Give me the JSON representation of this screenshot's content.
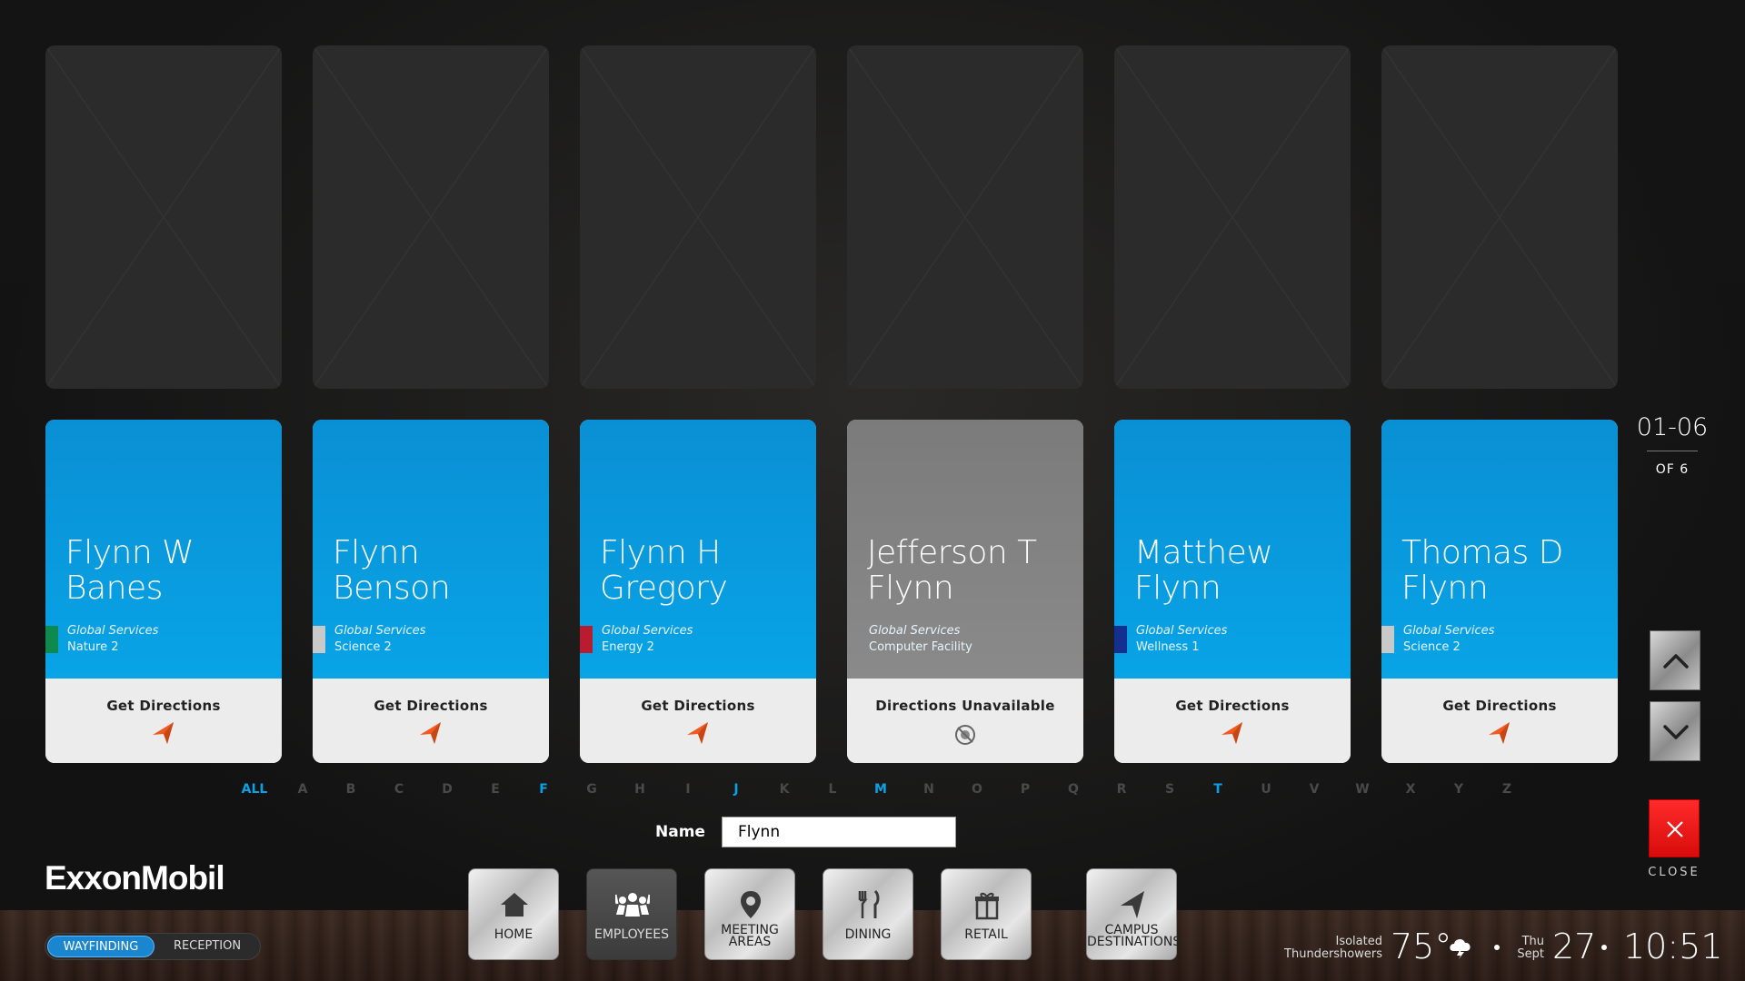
{
  "employees": [
    {
      "name": "Flynn W Banes",
      "dept": "Global Services",
      "location": "Nature 2",
      "action": "Get Directions",
      "swatch": "#0f8a4f",
      "available": true
    },
    {
      "name": "Flynn Benson",
      "dept": "Global Services",
      "location": "Science 2",
      "action": "Get Directions",
      "swatch": "#c9c9c9",
      "available": true
    },
    {
      "name": "Flynn H Gregory",
      "dept": "Global Services",
      "location": "Energy 2",
      "action": "Get Directions",
      "swatch": "#b81c2e",
      "available": true
    },
    {
      "name": "Jefferson T Flynn",
      "dept": "Global Services",
      "location": "Computer Facility",
      "action": "Directions Unavailable",
      "swatch": "",
      "available": false
    },
    {
      "name": "Matthew Flynn",
      "dept": "Global Services",
      "location": "Wellness 1",
      "action": "Get Directions",
      "swatch": "#13308f",
      "available": true
    },
    {
      "name": "Thomas D Flynn",
      "dept": "Global Services",
      "location": "Science 2",
      "action": "Get Directions",
      "swatch": "#c9c9c9",
      "available": true
    }
  ],
  "pagination": {
    "range": "01-06",
    "of": "OF 6"
  },
  "alphabet": [
    {
      "letter": "ALL",
      "active": true
    },
    {
      "letter": "A",
      "active": false
    },
    {
      "letter": "B",
      "active": false
    },
    {
      "letter": "C",
      "active": false
    },
    {
      "letter": "D",
      "active": false
    },
    {
      "letter": "E",
      "active": false
    },
    {
      "letter": "F",
      "active": true
    },
    {
      "letter": "G",
      "active": false
    },
    {
      "letter": "H",
      "active": false
    },
    {
      "letter": "I",
      "active": false
    },
    {
      "letter": "J",
      "active": true
    },
    {
      "letter": "K",
      "active": false
    },
    {
      "letter": "L",
      "active": false
    },
    {
      "letter": "M",
      "active": true
    },
    {
      "letter": "N",
      "active": false
    },
    {
      "letter": "O",
      "active": false
    },
    {
      "letter": "P",
      "active": false
    },
    {
      "letter": "Q",
      "active": false
    },
    {
      "letter": "R",
      "active": false
    },
    {
      "letter": "S",
      "active": false
    },
    {
      "letter": "T",
      "active": true
    },
    {
      "letter": "U",
      "active": false
    },
    {
      "letter": "V",
      "active": false
    },
    {
      "letter": "W",
      "active": false
    },
    {
      "letter": "X",
      "active": false
    },
    {
      "letter": "Y",
      "active": false
    },
    {
      "letter": "Z",
      "active": false
    }
  ],
  "search": {
    "label": "Name",
    "value": "Flynn"
  },
  "logo": "ExxonMobil",
  "mode_toggle": {
    "options": [
      "WAYFINDING",
      "RECEPTION"
    ],
    "active": "WAYFINDING"
  },
  "nav": [
    {
      "label": "HOME",
      "icon": "house-icon",
      "active": false
    },
    {
      "label": "EMPLOYEES",
      "icon": "people-icon",
      "active": true
    },
    {
      "label": "MEETING\nAREAS",
      "icon": "map-pin-icon",
      "active": false
    },
    {
      "label": "DINING",
      "icon": "fork-knife-icon",
      "active": false
    },
    {
      "label": "RETAIL",
      "icon": "gift-icon",
      "active": false
    },
    {
      "label": "CAMPUS\nDESTINATIONS",
      "icon": "navigation-arrow-icon",
      "active": false
    }
  ],
  "close_label": "CLOSE",
  "weather": {
    "description": "Isolated Thundershowers",
    "temperature": "75°",
    "icon": "thunder-cloud-icon"
  },
  "datetime": {
    "weekday": "Thu",
    "month": "Sept",
    "day": "27",
    "time": "10:51"
  },
  "colors": {
    "accent": "#0aa2e6",
    "card_blue": "#08a4e6",
    "nav_arrow": "#f05a22",
    "close_red": "#e81818"
  }
}
